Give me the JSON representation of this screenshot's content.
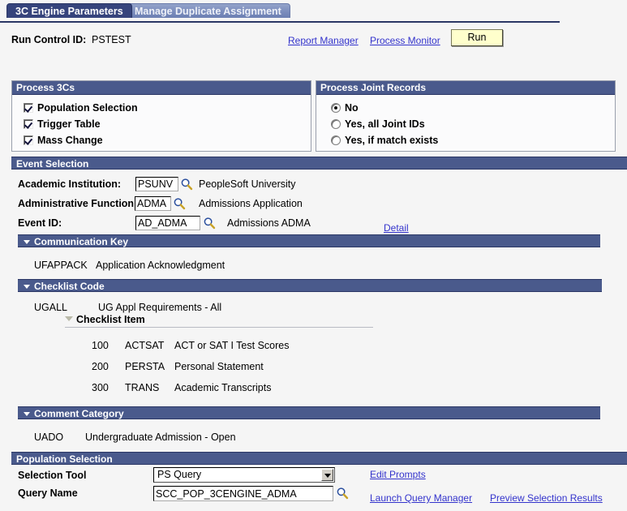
{
  "tabs": [
    {
      "label": "3C Engine Parameters",
      "active": true
    },
    {
      "label": "Manage Duplicate Assignment",
      "active": false
    }
  ],
  "run_control": {
    "label": "Run Control ID:",
    "value": "PSTEST",
    "report_manager_link": "Report Manager",
    "process_monitor_link": "Process Monitor",
    "run_button": "Run"
  },
  "process_3cs": {
    "title": "Process 3Cs",
    "options": [
      {
        "label": "Population Selection",
        "checked": true
      },
      {
        "label": "Trigger Table",
        "checked": true
      },
      {
        "label": "Mass Change",
        "checked": true
      }
    ]
  },
  "process_joint_records": {
    "title": "Process Joint Records",
    "options": [
      {
        "label": "No",
        "selected": true
      },
      {
        "label": "Yes, all Joint IDs",
        "selected": false
      },
      {
        "label": "Yes, if match exists",
        "selected": false
      }
    ]
  },
  "event_selection": {
    "title": "Event Selection",
    "academic_institution": {
      "label": "Academic Institution:",
      "value": "PSUNV",
      "description": "PeopleSoft University"
    },
    "administrative_function": {
      "label": "Administrative Function:",
      "value": "ADMA",
      "description": "Admissions Application"
    },
    "event_id": {
      "label": "Event ID:",
      "value": "AD_ADMA",
      "description": "Admissions ADMA"
    },
    "detail_link": "Detail"
  },
  "communication_key": {
    "title": "Communication Key",
    "code": "UFAPPACK",
    "description": "Application Acknowledgment"
  },
  "checklist_code": {
    "title": "Checklist Code",
    "code": "UGALL",
    "description": "UG Appl Requirements - All",
    "items_title": "Checklist Item",
    "items": [
      {
        "seq": "100",
        "code": "ACTSAT",
        "description": "ACT or SAT I Test Scores"
      },
      {
        "seq": "200",
        "code": "PERSTA",
        "description": "Personal Statement"
      },
      {
        "seq": "300",
        "code": "TRANS",
        "description": "Academic Transcripts"
      }
    ]
  },
  "comment_category": {
    "title": "Comment Category",
    "code": "UADO",
    "description": "Undergraduate Admission - Open"
  },
  "population_selection": {
    "title": "Population Selection",
    "selection_tool": {
      "label": "Selection Tool",
      "value": "PS Query"
    },
    "query_name": {
      "label": "Query Name",
      "value": "SCC_POP_3CENGINE_ADMA"
    },
    "edit_prompts_link": "Edit Prompts",
    "launch_query_manager_link": "Launch Query Manager",
    "preview_selection_results_link": "Preview Selection Results"
  },
  "colors": {
    "header_bar": "#4a5a8c",
    "active_tab": "#36447c",
    "link": "#3333cc",
    "run_button": "#ffffcc"
  }
}
